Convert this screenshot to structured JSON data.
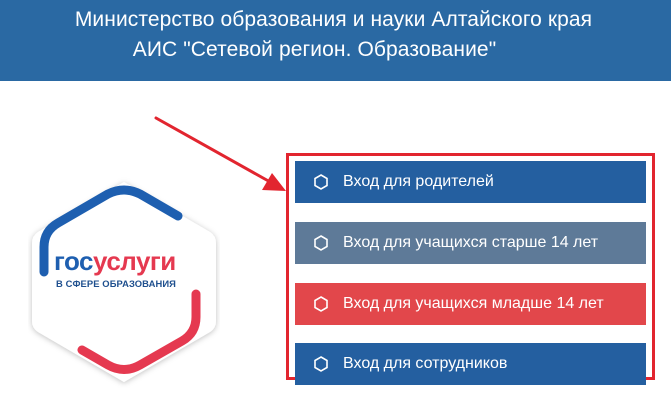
{
  "header": {
    "line1": "Министерство образования и науки Алтайского края",
    "line2": "АИС \"Сетевой регион. Образование\"",
    "background": "#2a69a3"
  },
  "logo": {
    "part1": "гос",
    "part2": "услуги",
    "subtitle": "В СФЕРЕ ОБРАЗОВАНИЯ",
    "colors": {
      "blue": "#1e5fb0",
      "red": "#e53950"
    }
  },
  "login_menu": {
    "frame_color": "#e2252f",
    "items": [
      {
        "label": "Вход для родителей",
        "icon": "hexagon-icon",
        "color": "#245fa0"
      },
      {
        "label": "Вход для учащихся старше 14 лет",
        "icon": "hexagon-icon",
        "color": "#5e7a98"
      },
      {
        "label": "Вход для учащихся младше 14 лет",
        "icon": "hexagon-icon",
        "color": "#e2474b"
      },
      {
        "label": "Вход для сотрудников",
        "icon": "hexagon-icon",
        "color": "#245fa0"
      }
    ]
  },
  "annotation": {
    "icon": "red-arrow-icon",
    "color": "#e2252f"
  }
}
